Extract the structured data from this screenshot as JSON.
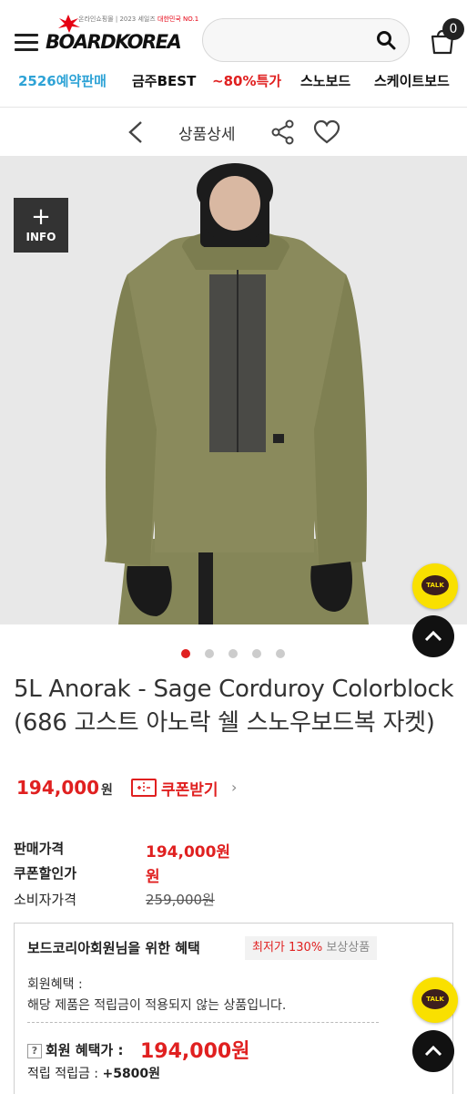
{
  "header": {
    "logo_text": "BOARDKOREA",
    "logo_tagline_left": "온라인쇼핑몰 | 2023 세일즈 ",
    "logo_tagline_right": "대한민국 NO.1",
    "cart_count": "0"
  },
  "categories": [
    {
      "label": "2526예약판매",
      "color": "blue"
    },
    {
      "label": "금주BEST",
      "color": "default"
    },
    {
      "label": "~80%특가",
      "color": "red"
    },
    {
      "label": "스노보드",
      "color": "default"
    },
    {
      "label": "스케이트보드",
      "color": "default"
    }
  ],
  "subheader": {
    "title": "상품상세"
  },
  "image": {
    "info_label": "INFO",
    "info_plus": "+",
    "slide_count": 5,
    "active_slide": 0
  },
  "talk": {
    "label": "TALK"
  },
  "product": {
    "title": "5L Anorak - Sage Corduroy Colorblock (686 고스트 아노락 쉘 스노우보드복 자켓)",
    "price": "194,000",
    "price_unit": "원",
    "coupon_label": "쿠폰받기",
    "coupon_chevron": "›"
  },
  "price_info": [
    {
      "label": "판매가격",
      "value": "194,000원",
      "style": "red"
    },
    {
      "label": "쿠폰할인가",
      "value": "원",
      "style": "red"
    },
    {
      "label": "소비자가격",
      "value": "259,000원",
      "style": "strike"
    }
  ],
  "benefit": {
    "title": "보드코리아회원님을 위한 혜택",
    "tag_red": "최저가 130%",
    "tag_gray": " 보상상품",
    "member_benefit_label": "회원혜택 :",
    "member_benefit_text": "해당 제품은 적립금이 적용되지 않는 상품입니다.",
    "help": "?",
    "member_price_label": "회원 혜택가 :",
    "member_price_value": "194,000원",
    "points_label": "적립 적립금 : ",
    "points_value": "+5800원"
  },
  "colors": {
    "accent_red": "#e02020",
    "accent_blue": "#2fa3d6",
    "kakao_yellow": "#f9e000",
    "jacket": "#8a8a5c"
  }
}
